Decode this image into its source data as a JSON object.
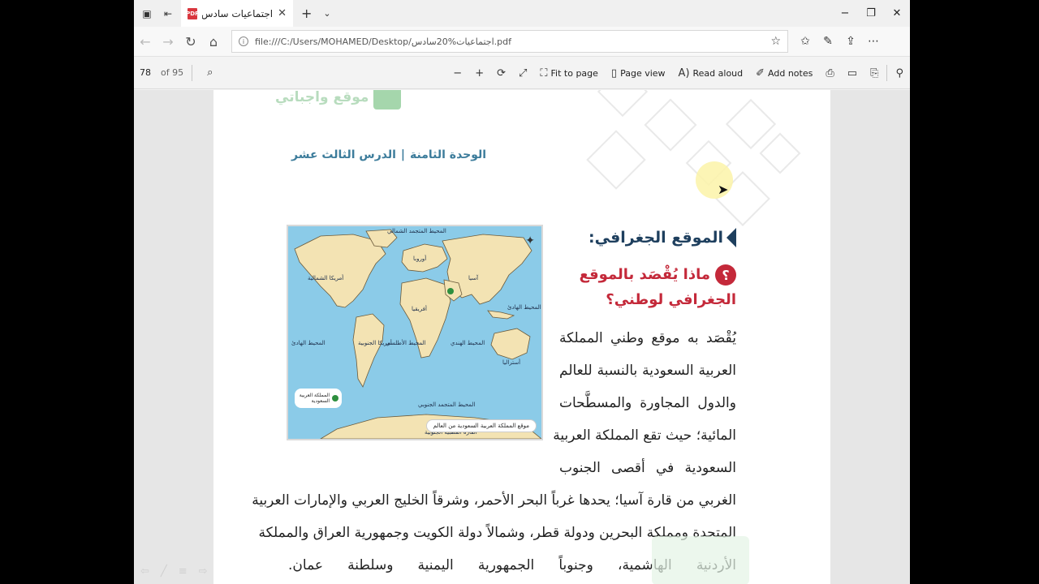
{
  "tab": {
    "title": "اجتماعيات سادس.pdf",
    "icon": "pdf-icon"
  },
  "window": {
    "minimize": "−",
    "maximize": "❐",
    "close": "✕"
  },
  "address": {
    "url": "file:///C:/Users/MOHAMED/Desktop/اجتماعيات%20سادس.pdf"
  },
  "pdf_toolbar": {
    "page_number": "78",
    "page_total": "of 95",
    "fit_to_page": "Fit to page",
    "page_view": "Page view",
    "read_aloud": "Read aloud",
    "add_notes": "Add notes"
  },
  "page": {
    "logo_text": "موقع واجباتي",
    "unit_label": "الوحدة الثامنة",
    "lesson_label": "الدرس الثالث عشر",
    "heading": "الموقع الجغرافي:",
    "question_badge": "؟",
    "question": "ماذا يُقْصَد بالموقع الجغرافي لوطني؟",
    "body_narrow": [
      "يُقْصَد به موقع وطني المملكة",
      "العربية السعودية بالنسبة للعالم",
      "والدول المجاورة والمسطَّحات",
      "المائية؛ حيث تقع المملكة العربية",
      "السعودية في أقصى الجنوب"
    ],
    "body_wide": [
      "الغربي من قارة آسيا؛ يحدها غرباً البحر الأحمر، وشرقاً الخليج العربي والإمارات العربية",
      "المتحدة ومملكة البحرين ودولة قطر، وشمالاً دولة الكويت وجمهورية العراق والمملكة",
      "الأردنية الهاشمية، وجنوباً الجمهورية اليمنية وسلطنة عمان."
    ]
  },
  "map": {
    "labels": {
      "arctic": "المحيط المتجمد الشمالي",
      "north_america": "أمريكا الشمالية",
      "europe": "أوروبا",
      "asia": "آسيا",
      "africa": "أفريقيا",
      "south_america": "أمريكا الجنوبية",
      "australia": "أستراليا",
      "pacific_east": "المحيط الهادئ",
      "pacific_west": "المحيط الهادئ",
      "atlantic": "المحيط الأطلسي",
      "indian": "المحيط الهندي",
      "southern": "المحيط المتجمد الجنوبي",
      "antarctica": "القارة القطبية الجنوبية"
    },
    "legend": "المملكة العربية السعودية",
    "caption": "موقع المملكة العربية السعودية من العالم"
  }
}
